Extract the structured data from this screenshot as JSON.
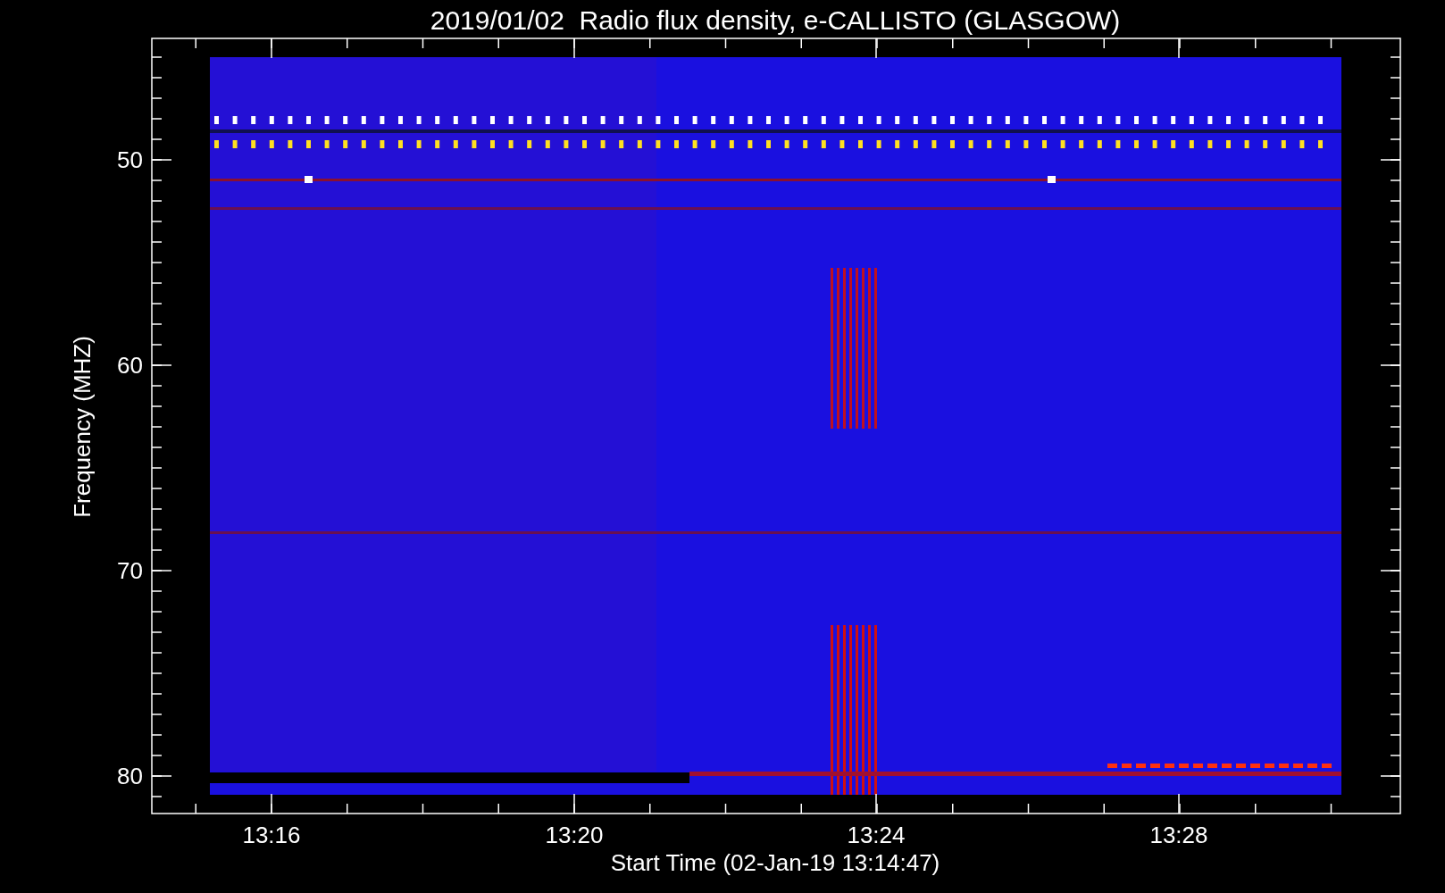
{
  "title": "2019/01/02  Radio flux density, e-CALLISTO (GLASGOW)",
  "y_axis": {
    "label": "Frequency (MHZ)",
    "ticks": [
      "50",
      "60",
      "70",
      "80"
    ]
  },
  "x_axis": {
    "label": "Start Time (02-Jan-19 13:14:47)",
    "ticks": [
      "13:16",
      "13:20",
      "13:24",
      "13:28"
    ]
  }
}
